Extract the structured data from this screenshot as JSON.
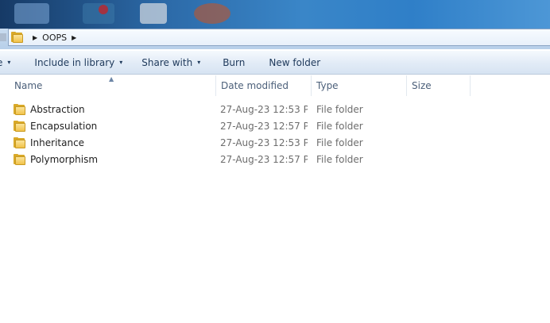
{
  "address": {
    "path_segments": [
      "OOPS"
    ]
  },
  "toolbar": {
    "organize_caret": "▾",
    "include_in_library": "Include in library",
    "share_with": "Share with",
    "burn": "Burn",
    "new_folder": "New folder"
  },
  "columns": {
    "name": "Name",
    "date_modified": "Date modified",
    "type": "Type",
    "size": "Size"
  },
  "files": [
    {
      "name": "Abstraction",
      "date_modified": "27-Aug-23 12:53 P...",
      "type": "File folder",
      "icon": "folder-icon"
    },
    {
      "name": "Encapsulation",
      "date_modified": "27-Aug-23 12:57 P...",
      "type": "File folder",
      "icon": "folder-icon"
    },
    {
      "name": "Inheritance",
      "date_modified": "27-Aug-23 12:53 P...",
      "type": "File folder",
      "icon": "folder-icon"
    },
    {
      "name": "Polymorphism",
      "date_modified": "27-Aug-23 12:57 P...",
      "type": "File folder",
      "icon": "folder-icon"
    }
  ],
  "colors": {
    "toolbar_text": "#1e395b",
    "header_text": "#4c607a",
    "folder_yellow": "#f1c24a"
  }
}
